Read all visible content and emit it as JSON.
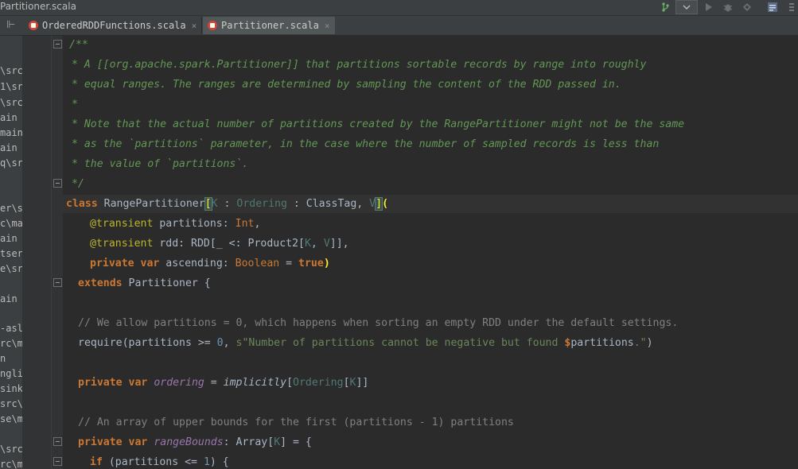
{
  "window": {
    "title": "Partitioner.scala"
  },
  "toolbar": {
    "branch_icon": "git-branch-icon",
    "run_icon": "run-icon",
    "debug_icon": "debug-icon",
    "coverage_icon": "coverage-icon",
    "vcs_icon": "vcs-icon"
  },
  "tabs": [
    {
      "label": "OrderedRDDFunctions.scala",
      "active": false,
      "close": "×"
    },
    {
      "label": "Partitioner.scala",
      "active": true,
      "close": "×"
    }
  ],
  "project_panel": {
    "items": [
      "\\src",
      "1\\src",
      "\\src",
      "ain",
      "main",
      "ain",
      "q\\sr",
      "",
      "er\\s",
      "c\\ma",
      "ain",
      "tser",
      "e\\sr",
      "",
      "ain",
      "",
      "-asl",
      "rc\\m",
      "n",
      "ngli",
      "sink",
      "src\\",
      "se\\m",
      "",
      "\\src",
      "rc\\m"
    ]
  },
  "colors": {
    "background": "#2b2b2b",
    "gutter": "#313335",
    "keyword": "#cc7832",
    "doc_comment": "#629755",
    "line_comment": "#808080",
    "string": "#6a8759",
    "number": "#6897bb",
    "field": "#9876aa",
    "annotation": "#bbb529",
    "type_param": "#507874",
    "default_text": "#a9b7c6"
  },
  "code": {
    "l1": {
      "c1": "/**"
    },
    "l2": {
      "c1": " * A [[org.apache.spark.Partitioner]] that partitions sortable records by range into roughly"
    },
    "l3": {
      "c1": " * equal ranges. The ranges are determined by sampling the content of the RDD passed in."
    },
    "l4": {
      "c1": " *"
    },
    "l5": {
      "c1": " * Note that the actual number of partitions created by the RangePartitioner might not be the same"
    },
    "l6": {
      "c1": " * as the `partitions` parameter, in the case where the number of sampled records is less than"
    },
    "l7": {
      "c1": " * the value of `partitions`."
    },
    "l8": {
      "c1": " */"
    },
    "l9": {
      "kw": "class",
      "name": " RangePartitioner",
      "lb": "[",
      "k": "K",
      "sep1": " : ",
      "ord": "Ordering",
      "sep2": " : ClassTag, ",
      "v": "V",
      "rb": "]",
      "lp": "("
    },
    "l10": {
      "ann": "@transient",
      "rest1": " partitions: ",
      "type": "Int",
      "comma": ","
    },
    "l11": {
      "ann": "@transient",
      "rest1": " rdd: RDD[_ <: Product2[",
      "k": "K",
      "mid": ", ",
      "v": "V",
      "rest2": "]],"
    },
    "l12": {
      "kw1": "private",
      "sp": " ",
      "kw2": "var",
      "rest1": " ascending: ",
      "type": "Boolean",
      "eq": " = ",
      "val": "true",
      "rp": ")"
    },
    "l13": {
      "kw": "extends",
      "rest": " Partitioner {"
    },
    "l14": {
      "c1": ""
    },
    "l15": {
      "c1": "// We allow partitions = 0, which happens when sorting an empty RDD under the default settings."
    },
    "l16": {
      "fn": "require",
      "rest1": "(partitions >= ",
      "num": "0",
      "comma": ", ",
      "s1": "s\"Number of partitions cannot be negative but found ",
      "dollar": "$",
      "var": "partitions",
      "s2": ".\"",
      "rp": ")"
    },
    "l17": {
      "c1": ""
    },
    "l18": {
      "kw1": "private",
      "sp": " ",
      "kw2": "var",
      "sp2": " ",
      "field": "ordering",
      "eq": " = ",
      "fn": "implicitly",
      "lb": "[",
      "ord": "Ordering",
      "lb2": "[",
      "k": "K",
      "rb": "]]"
    },
    "l19": {
      "c1": ""
    },
    "l20": {
      "c1": "// An array of upper bounds for the first (partitions - 1) partitions"
    },
    "l21": {
      "kw1": "private",
      "sp": " ",
      "kw2": "var",
      "sp2": " ",
      "field": "rangeBounds",
      "rest1": ": Array[",
      "k": "K",
      "rest2": "] = {"
    },
    "l22": {
      "kw": "if",
      "rest1": " (partitions <= ",
      "num": "1",
      "rest2": ") {"
    }
  }
}
